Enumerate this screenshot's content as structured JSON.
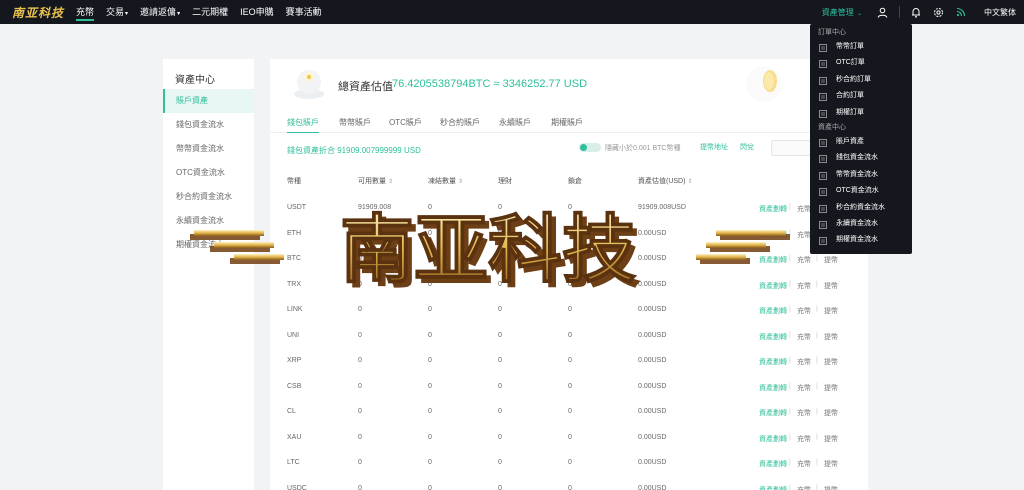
{
  "nav": {
    "logo": "南亚科技",
    "items": [
      {
        "label": "充幣",
        "active": true,
        "caret": false
      },
      {
        "label": "交易",
        "active": false,
        "caret": true
      },
      {
        "label": "邀請返傭",
        "active": false,
        "caret": true
      },
      {
        "label": "二元期權",
        "active": false,
        "caret": false
      },
      {
        "label": "IEO申購",
        "active": false,
        "caret": false
      },
      {
        "label": "賽事活動",
        "active": false,
        "caret": false
      }
    ],
    "asset_mgmt": "資產管理",
    "language": "中文繁体",
    "icons": [
      "user-icon",
      "bell-icon",
      "settings-icon",
      "rss-icon"
    ]
  },
  "sidebar": {
    "title": "資產中心",
    "items": [
      "賬戶資產",
      "錢包資金流水",
      "幣幣資金流水",
      "OTC資金流水",
      "秒合約資金流水",
      "永續資金流水",
      "期權資金流水"
    ]
  },
  "hero": {
    "label": "總資產估值",
    "value": "76.4205538794BTC ≈ 3346252.77 USD"
  },
  "tabs": [
    "錢包賬戶",
    "幣幣賬戶",
    "OTC賬戶",
    "秒合約賬戶",
    "永續賬戶",
    "期權賬戶"
  ],
  "summary": "錢包資產折合 91909.007999999 USD",
  "filters": {
    "hide_small": "隱藏小於0.001 BTC幣種",
    "deposit_address": "提幣地址",
    "exchange": "閃兌"
  },
  "table": {
    "headers": [
      "幣種",
      "可用數量",
      "凍結數量",
      "理財",
      "鎖倉",
      "資產估值(USD)"
    ],
    "rows": [
      [
        "USDT",
        "91909.008",
        "0",
        "0",
        "0",
        "91909.008USD"
      ],
      [
        "ETH",
        "0",
        "0",
        "0",
        "0",
        "0.00USD"
      ],
      [
        "BTC",
        "0",
        "0",
        "0",
        "0",
        "0.00USD"
      ],
      [
        "TRX",
        "0",
        "0",
        "0",
        "0",
        "0.00USD"
      ],
      [
        "LINK",
        "0",
        "0",
        "0",
        "0",
        "0.00USD"
      ],
      [
        "UNI",
        "0",
        "0",
        "0",
        "0",
        "0.00USD"
      ],
      [
        "XRP",
        "0",
        "0",
        "0",
        "0",
        "0.00USD"
      ],
      [
        "CSB",
        "0",
        "0",
        "0",
        "0",
        "0.00USD"
      ],
      [
        "CL",
        "0",
        "0",
        "0",
        "0",
        "0.00USD"
      ],
      [
        "XAU",
        "0",
        "0",
        "0",
        "0",
        "0.00USD"
      ],
      [
        "LTC",
        "0",
        "0",
        "0",
        "0",
        "0.00USD"
      ],
      [
        "USDC",
        "0",
        "0",
        "0",
        "0",
        "0.00USD"
      ]
    ],
    "actions": [
      "資產劃轉",
      "充幣",
      "提幣"
    ]
  },
  "dropdown": {
    "order_group": "訂單中心",
    "order_items": [
      "幣幣訂單",
      "OTC訂單",
      "秒合約訂單",
      "合約訂單",
      "期權訂單"
    ],
    "asset_group": "資產中心",
    "asset_items": [
      "賬戶資產",
      "錢包資金流水",
      "幣幣資金流水",
      "OTC資金流水",
      "秒合約資金流水",
      "永續資金流水",
      "期權資金流水"
    ]
  },
  "watermark": "南亚科技",
  "colors": {
    "accent": "#2fbf9b",
    "nav_bg": "#15171e",
    "page_bg": "#f2f3f5"
  }
}
